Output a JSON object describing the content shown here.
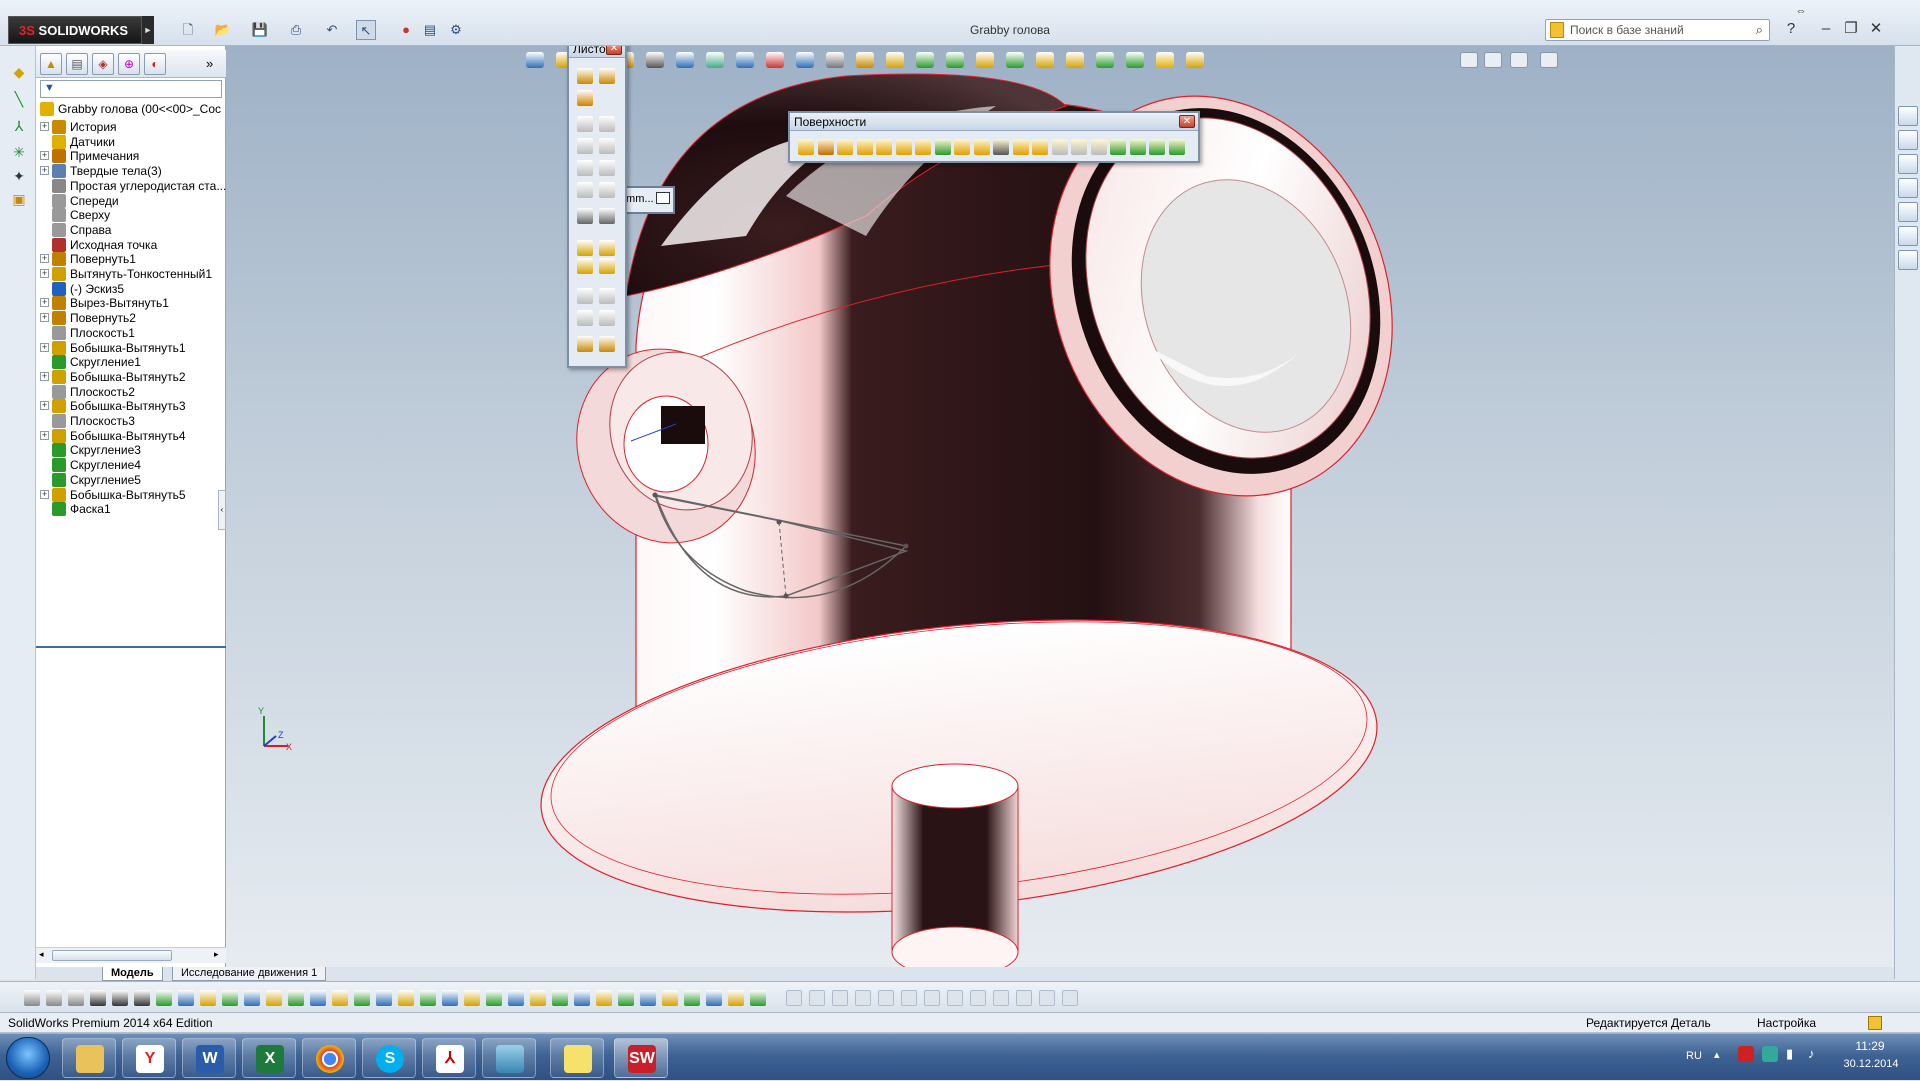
{
  "app": {
    "logo_text": "SOLIDWORKS",
    "logo_prefix": "3S",
    "document_title": "Grabby голова",
    "search_placeholder": "Поиск в базе знаний"
  },
  "feature_tree": {
    "root_label": "Grabby голова  (00<<00>_Coc",
    "items": [
      {
        "label": "История",
        "expandable": true
      },
      {
        "label": "Датчики",
        "expandable": false
      },
      {
        "label": "Примечания",
        "expandable": true
      },
      {
        "label": "Твердые тела(3)",
        "expandable": true
      },
      {
        "label": "Простая углеродистая ста...",
        "expandable": false
      },
      {
        "label": "Спереди",
        "expandable": false
      },
      {
        "label": "Сверху",
        "expandable": false
      },
      {
        "label": "Справа",
        "expandable": false
      },
      {
        "label": "Исходная точка",
        "expandable": false
      },
      {
        "label": "Повернуть1",
        "expandable": true
      },
      {
        "label": "Вытянуть-Тонкостенный1",
        "expandable": true
      },
      {
        "label": "(-) Эскиз5",
        "expandable": false
      },
      {
        "label": "Вырез-Вытянуть1",
        "expandable": true
      },
      {
        "label": "Повернуть2",
        "expandable": true
      },
      {
        "label": "Плоскость1",
        "expandable": false
      },
      {
        "label": "Бобышка-Вытянуть1",
        "expandable": true
      },
      {
        "label": "Скругление1",
        "expandable": false
      },
      {
        "label": "Бобышка-Вытянуть2",
        "expandable": true
      },
      {
        "label": "Плоскость2",
        "expandable": false
      },
      {
        "label": "Бобышка-Вытянуть3",
        "expandable": true
      },
      {
        "label": "Плоскость3",
        "expandable": false
      },
      {
        "label": "Бобышка-Вытянуть4",
        "expandable": true
      },
      {
        "label": "Скругление3",
        "expandable": false
      },
      {
        "label": "Скругление4",
        "expandable": false
      },
      {
        "label": "Скругление5",
        "expandable": false
      },
      {
        "label": "Бобышка-Вытянуть5",
        "expandable": true
      },
      {
        "label": "Фаска1",
        "expandable": false
      }
    ]
  },
  "floating": {
    "sheet_metal_title": "Листо...",
    "surfaces_title": "Поверхности",
    "commandmanager_label": "Comm..."
  },
  "bottom_tabs": {
    "model": "Модель",
    "motion": "Исследование движения 1"
  },
  "status": {
    "edition": "SolidWorks Premium 2014 x64 Edition",
    "mode": "Редактируется Деталь",
    "custom": "Настройка"
  },
  "taskbar": {
    "language": "RU",
    "time": "11:29",
    "date": "30.12.2014"
  },
  "triad": {
    "x": "X",
    "y": "Y",
    "z": "Z"
  },
  "colors": {
    "accent": "#3a6ea8",
    "model_edge": "#e0202a",
    "model_dark": "#2b1416",
    "model_light": "#fbe5e5"
  }
}
